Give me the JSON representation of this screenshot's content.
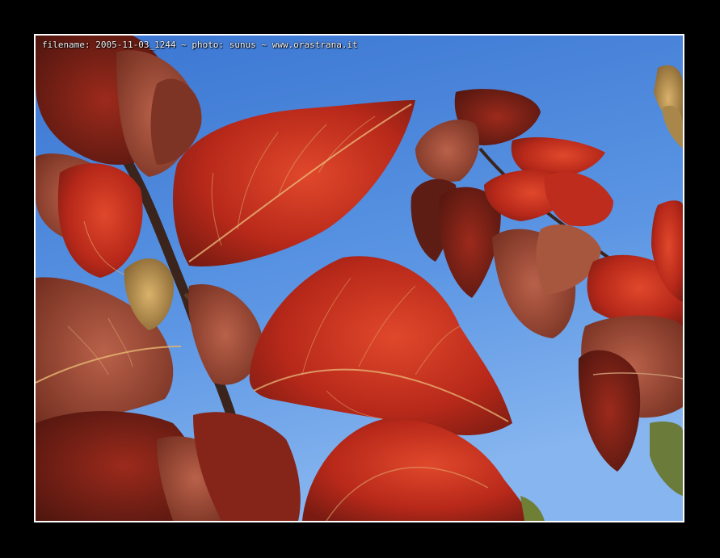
{
  "caption": "filename: 2005-11-03_1244 ~ photo: sunus ~ www.orastrana.it",
  "colors": {
    "frame": "#000000",
    "border": "#ffffff",
    "sky_top": "#3f7cd6",
    "sky_bottom": "#7fb0ee",
    "leaf_red": "#b3261a",
    "leaf_dark": "#5a1a12",
    "leaf_bright": "#d8442a",
    "vein": "#e3b070",
    "stem": "#3b241c"
  }
}
